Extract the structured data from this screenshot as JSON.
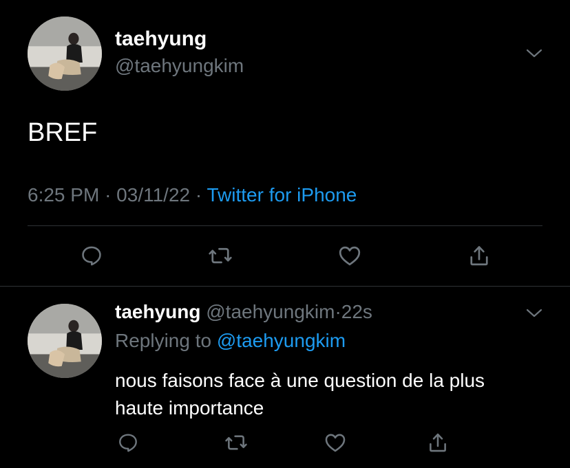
{
  "main_tweet": {
    "display_name": "taehyung",
    "handle": "@taehyungkim",
    "text": "BREF",
    "time": "6:25 PM",
    "separator": "·",
    "date": "03/11/22",
    "source": "Twitter for iPhone"
  },
  "reply": {
    "display_name": "taehyung",
    "handle": "@taehyungkim",
    "separator": "·",
    "age": "22s",
    "replying_label": "Replying to",
    "replying_handle": "@taehyungkim",
    "text_line1": "nous faisons face à une question de la plus",
    "text_line2": "haute importance"
  },
  "icons": {
    "reply": "reply-icon",
    "retweet": "retweet-icon",
    "like": "heart-icon",
    "share": "share-icon",
    "more": "chevron-down-icon"
  },
  "colors": {
    "background": "#000000",
    "text": "#ffffff",
    "muted": "#6e767d",
    "accent": "#1d9bf0",
    "divider": "#2f3336"
  }
}
